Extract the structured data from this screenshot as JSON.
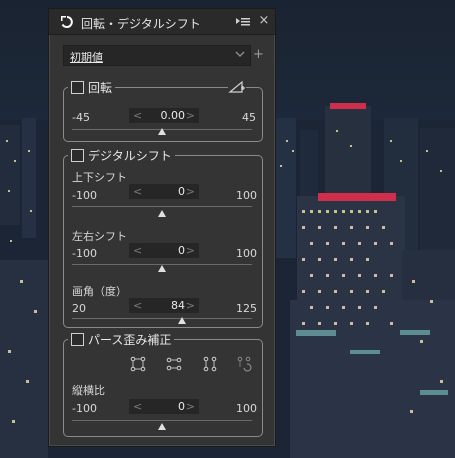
{
  "panel": {
    "title": "回転・デジタルシフト",
    "title_icon": "rotate-arrow-icon",
    "menu_icon": "panel-menu-icon",
    "close_label": "×"
  },
  "preset": {
    "value": "初期値",
    "add_label": "+"
  },
  "rotation": {
    "title": "回転",
    "checked": false,
    "min": "-45",
    "value": "0.00",
    "max": "45",
    "level": 0.5,
    "tool_icon": "angle-ruler-icon"
  },
  "shift": {
    "title": "デジタルシフト",
    "checked": false,
    "vertical": {
      "label": "上下シフト",
      "min": "-100",
      "value": "0",
      "max": "100",
      "level": 0.5
    },
    "horizontal": {
      "label": "左右シフト",
      "min": "-100",
      "value": "0",
      "max": "100",
      "level": 0.5
    },
    "angle": {
      "label": "画角（度）",
      "min": "20",
      "value": "84",
      "max": "125",
      "level": 0.61
    }
  },
  "perspective": {
    "title": "パース歪み補正",
    "checked": false,
    "tools": [
      "perspective-4point-icon",
      "perspective-horizontal-icon",
      "perspective-vertical-icon",
      "perspective-reset-icon"
    ],
    "aspect": {
      "label": "縦横比",
      "min": "-100",
      "value": "0",
      "max": "100",
      "level": 0.5
    }
  },
  "spin_arrows": {
    "left": "<",
    "right": ">"
  }
}
